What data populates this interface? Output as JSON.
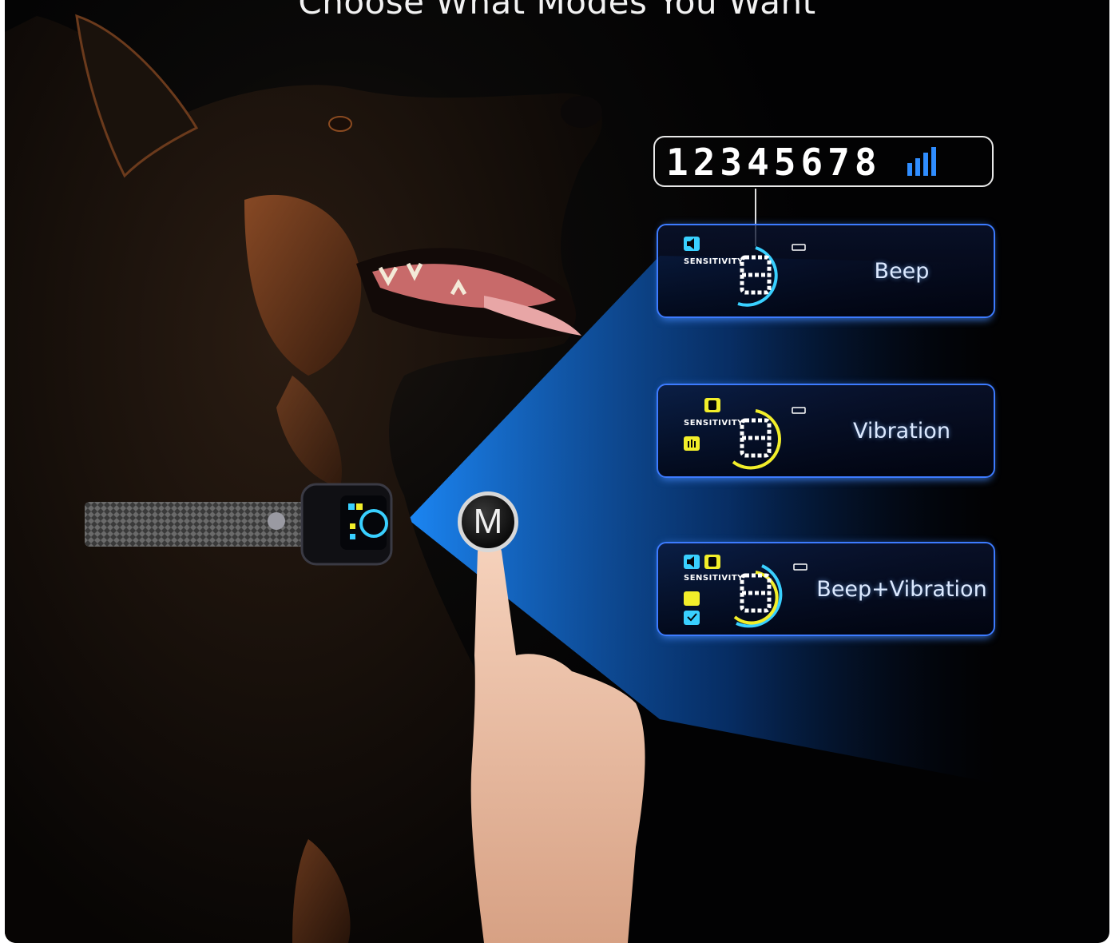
{
  "title": "Choose What Modes You Want",
  "level_display": {
    "digits": "12345678",
    "signal_bars": 4
  },
  "button": {
    "label": "M"
  },
  "modes": [
    {
      "name": "Beep",
      "sensitivity_label": "SENSITIVITY",
      "digit": "8",
      "ring_color": "#39d0ff"
    },
    {
      "name": "Vibration",
      "sensitivity_label": "SENSITIVITY",
      "digit": "8",
      "ring_color": "#f2ee2a"
    },
    {
      "name": "Beep+Vibration",
      "sensitivity_label": "SENSITIVITY",
      "digit": "8",
      "ring_color": "#f2ee2a"
    }
  ],
  "colors": {
    "accent_blue": "#3d7bff",
    "cyan": "#39d0ff",
    "yellow": "#f2ee2a",
    "background": "#050506"
  }
}
